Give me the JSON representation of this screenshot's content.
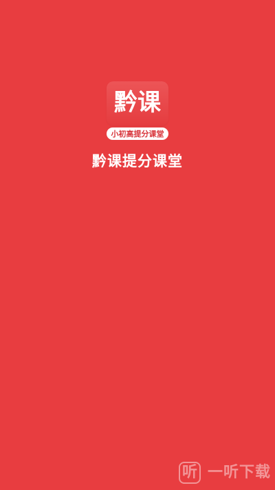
{
  "splash": {
    "logo_text": "黔课",
    "tagline": "小初高提分课堂",
    "app_title": "黔课提分课堂"
  },
  "watermark": {
    "icon_glyph": "听",
    "text": "一听下载"
  },
  "colors": {
    "background": "#e83d40",
    "text": "#ffffff",
    "tag_text": "#d8343a"
  }
}
